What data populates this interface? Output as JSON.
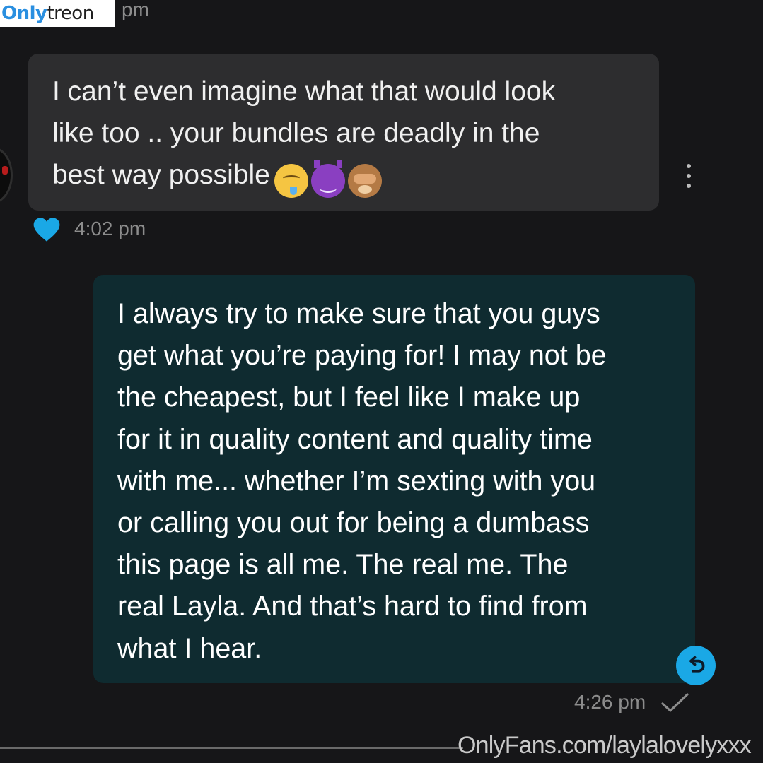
{
  "watermark": {
    "logo_bold": "Only",
    "logo_light": "treon",
    "url": "OnlyFans.com/laylalovelyxxx",
    "logo_color": "#2a8fe0"
  },
  "top_time": "pm",
  "incoming_message": {
    "text": "I can’t even imagine what that would look\nlike too .. your bundles are deadly in the\nbest way possible",
    "emojis": [
      "drooling-face-emoji",
      "smiling-devil-emoji",
      "see-no-evil-monkey-emoji"
    ],
    "time": "4:02 pm",
    "liked": true,
    "heart_color": "#1aa8e6",
    "bubble_color": "#2d2d2f"
  },
  "outgoing_message": {
    "text": "I always try to make sure that you guys\nget what you’re paying for! I may not be\nthe cheapest, but I feel like I make up\nfor it in quality content and quality time\nwith me... whether I’m sexting with you\nor calling you out for being a dumbass\nthis page is all me. The real me. The\nreal Layla. And that’s hard to find from\nwhat I hear.",
    "time": "4:26 pm",
    "status_icon": "check-icon",
    "bubble_color": "#0f2b30"
  },
  "colors": {
    "background": "#161618",
    "accent": "#1aa8e6"
  }
}
